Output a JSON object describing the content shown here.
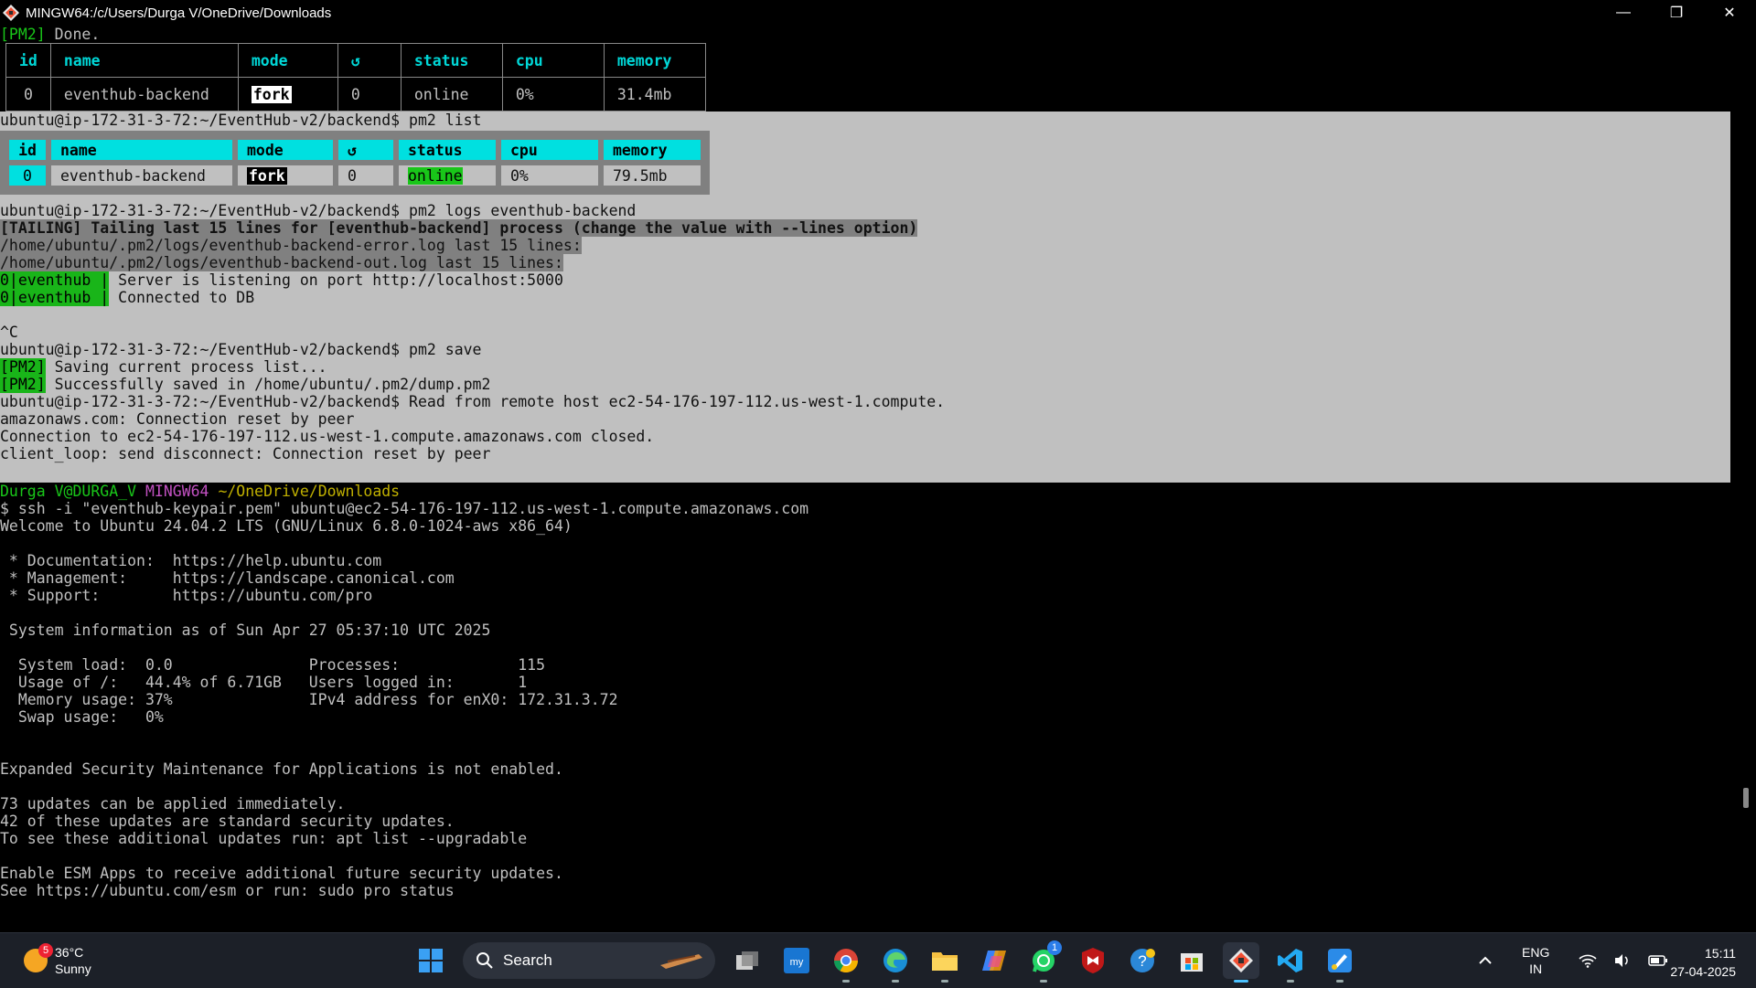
{
  "window": {
    "title": "MINGW64:/c/Users/Durga V/OneDrive/Downloads",
    "controls": [
      "—",
      "❐",
      "✕"
    ]
  },
  "terminal": {
    "done_prefix": "[PM2]",
    "done_text": " Done.",
    "table_headers": [
      "id",
      "name",
      "mode",
      "↺",
      "status",
      "cpu",
      "memory"
    ],
    "table1_row": [
      "0",
      "eventhub-backend",
      "fork",
      "0",
      "online",
      "0%",
      "31.4mb"
    ],
    "cmd_list": "ubuntu@ip-172-31-3-72:~/EventHub-v2/backend$ pm2 list",
    "table2_row": [
      "0",
      "eventhub-backend",
      "fork",
      "0",
      "online",
      "0%",
      "79.5mb"
    ],
    "cmd_logs": "ubuntu@ip-172-31-3-72:~/EventHub-v2/backend$ pm2 logs eventhub-backend",
    "tailing": "[TAILING] Tailing last 15 lines for [eventhub-backend] process (change the value with --lines option)",
    "errlog": "/home/ubuntu/.pm2/logs/eventhub-backend-error.log last 15 lines:",
    "outlog": "/home/ubuntu/.pm2/logs/eventhub-backend-out.log last 15 lines:",
    "log_prefix": "0|eventhub |",
    "log1": " Server is listening on port http://localhost:5000",
    "log2": " Connected to DB",
    "ctrlc": "^C",
    "cmd_save": "ubuntu@ip-172-31-3-72:~/EventHub-v2/backend$ pm2 save",
    "pm2_prefix": "[PM2]",
    "save1": " Saving current process list...",
    "save2": " Successfully saved in /home/ubuntu/.pm2/dump.pm2",
    "remote1": "ubuntu@ip-172-31-3-72:~/EventHub-v2/backend$ Read from remote host ec2-54-176-197-112.us-west-1.compute.",
    "remote2": "amazonaws.com: Connection reset by peer",
    "remote3": "Connection to ec2-54-176-197-112.us-west-1.compute.amazonaws.com closed.",
    "remote4": "client_loop: send disconnect: Connection reset by peer",
    "prompt_user": "Durga V@DURGA_V",
    "prompt_sys": "MINGW64",
    "prompt_path": "~/OneDrive/Downloads",
    "ssh_cmd": "$ ssh -i \"eventhub-keypair.pem\" ubuntu@ec2-54-176-197-112.us-west-1.compute.amazonaws.com",
    "welcome": "Welcome to Ubuntu 24.04.2 LTS (GNU/Linux 6.8.0-1024-aws x86_64)",
    "doc": " * Documentation:  https://help.ubuntu.com",
    "mgmt": " * Management:     https://landscape.canonical.com",
    "support": " * Support:        https://ubuntu.com/pro",
    "sysinfo": " System information as of Sun Apr 27 05:37:10 UTC 2025",
    "sys1": "  System load:  0.0               Processes:             115",
    "sys2": "  Usage of /:   44.4% of 6.71GB   Users logged in:       1",
    "sys3": "  Memory usage: 37%               IPv4 address for enX0: 172.31.3.72",
    "sys4": "  Swap usage:   0%",
    "esm": "Expanded Security Maintenance for Applications is not enabled.",
    "upd1": "73 updates can be applied immediately.",
    "upd2": "42 of these updates are standard security updates.",
    "upd3": "To see these additional updates run: apt list --upgradable",
    "esm1": "Enable ESM Apps to receive additional future security updates.",
    "esm2": "See https://ubuntu.com/esm or run: sudo pro status"
  },
  "taskbar": {
    "weather_badge": "5",
    "weather_temp": "36°C",
    "weather_desc": "Sunny",
    "search_label": "Search",
    "whatsapp_badge": "1",
    "lang1": "ENG",
    "lang2": "IN",
    "time": "15:11",
    "date": "27-04-2025"
  }
}
